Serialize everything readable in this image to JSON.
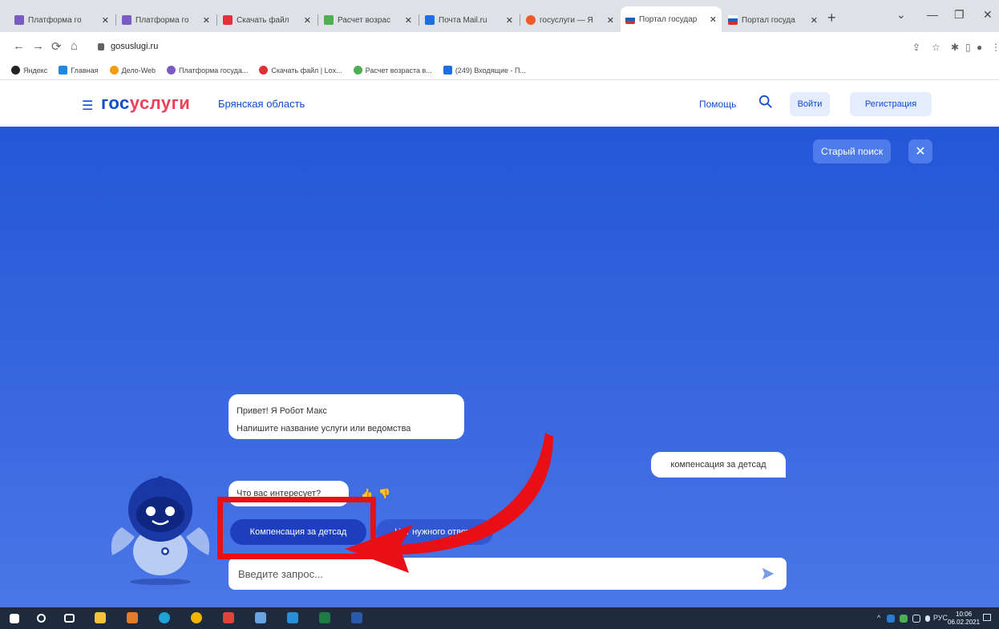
{
  "browser": {
    "tabs": [
      {
        "title": "Платформа го",
        "color": "#7a5bc2",
        "active": false
      },
      {
        "title": "Платформа го",
        "color": "#7a5bc2",
        "active": false
      },
      {
        "title": "Скачать файл",
        "color": "#e0303c",
        "active": false
      },
      {
        "title": "Расчет возрас",
        "color": "#4caf50",
        "active": false
      },
      {
        "title": "Почта Mail.ru",
        "color": "#1e6fe0",
        "active": false
      },
      {
        "title": "госуслуги — Я",
        "color": "#f05a28",
        "active": false
      },
      {
        "title": "Портал государ",
        "color": "#1565c0",
        "active": true
      },
      {
        "title": "Портал госуда",
        "color": "#d32f2f",
        "active": false
      }
    ],
    "url": "gosuslugi.ru",
    "bookmarks": [
      {
        "label": "Яндекс",
        "color": "#222"
      },
      {
        "label": "Главная",
        "color": "#1e88e5"
      },
      {
        "label": "Дело-Web",
        "color": "#f39c12"
      },
      {
        "label": "Платформа госуда...",
        "color": "#7a5bc2"
      },
      {
        "label": "Скачать файл | Lox...",
        "color": "#e0303c"
      },
      {
        "label": "Расчет возраста в...",
        "color": "#4caf50"
      },
      {
        "label": "(249) Входящие - П...",
        "color": "#1e6fe0"
      }
    ]
  },
  "site": {
    "logo_part1": "гос",
    "logo_part2": "услуги",
    "region": "Брянская область",
    "help": "Помощь",
    "login": "Войти",
    "register": "Регистрация",
    "old_search": "Старый поиск"
  },
  "chat": {
    "greeting_line1": "Привет! Я Робот Макс",
    "greeting_line2": "Напишите название услуги или ведомства",
    "user_message": "компенсация за детсад",
    "question": "Что вас интересует?",
    "option1": "Компенсация за детсад",
    "option2": "Нет нужного ответа",
    "input_placeholder": "Введите запрос..."
  },
  "taskbar": {
    "lang": "РУС",
    "time": "10:06",
    "date": "06.02.2021"
  },
  "colors": {
    "brand_blue": "#0d4cd3",
    "brand_red": "#ee3f58",
    "annotation_red": "#e81016"
  }
}
